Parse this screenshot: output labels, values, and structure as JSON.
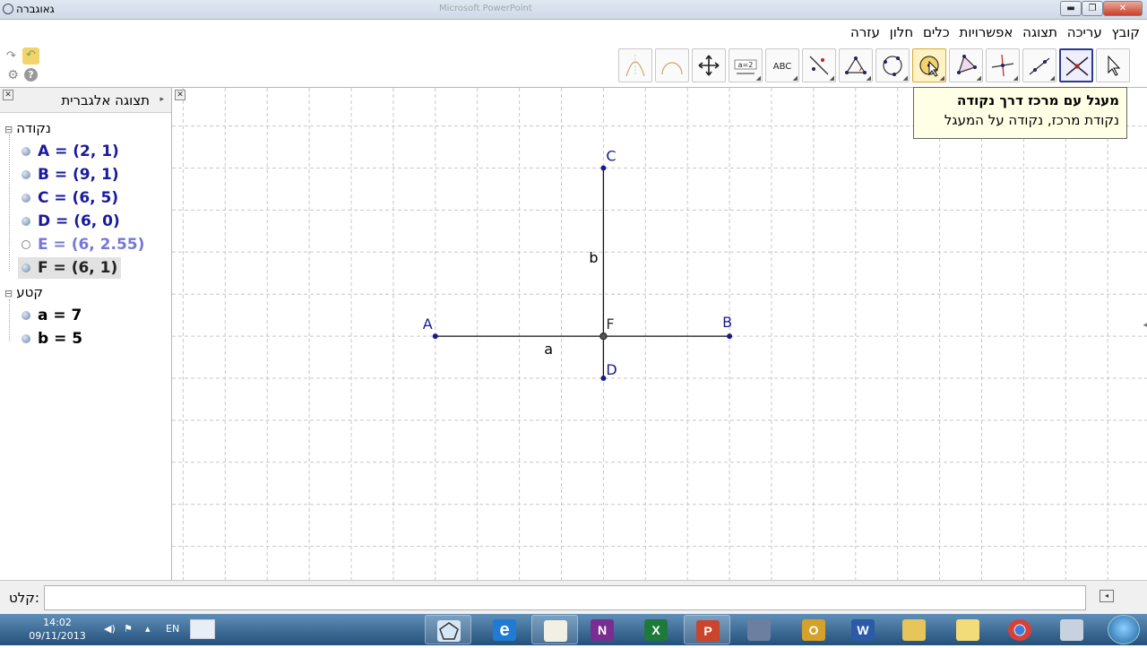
{
  "window": {
    "title": "גאוגברה",
    "background_title": "Microsoft PowerPoint",
    "controls": {
      "minimize": "▬",
      "maximize": "❐",
      "close": "✕"
    }
  },
  "menu": {
    "items": [
      "קובץ",
      "עריכה",
      "תצוגה",
      "אפשרויות",
      "כלים",
      "חלון",
      "עזרה"
    ]
  },
  "toolbar": {
    "tools": [
      {
        "name": "move-tool",
        "icon": "cursor-arrow"
      },
      {
        "name": "point-tool",
        "icon": "intersect-point",
        "active": true
      },
      {
        "name": "line-tool",
        "icon": "line"
      },
      {
        "name": "perpendicular-tool",
        "icon": "perpendicular"
      },
      {
        "name": "polygon-tool",
        "icon": "polygon"
      },
      {
        "name": "circle-tool",
        "icon": "circle-center-point"
      },
      {
        "name": "conic-tool",
        "icon": "circle-three-points"
      },
      {
        "name": "angle-tool",
        "icon": "angle"
      },
      {
        "name": "reflect-tool",
        "icon": "reflect-line"
      },
      {
        "name": "text-tool",
        "icon": "abc",
        "label": "ABC"
      },
      {
        "name": "slider-tool",
        "icon": "slider",
        "label": "a=2"
      },
      {
        "name": "move-view-tool",
        "icon": "move-view"
      },
      {
        "name": "function-tool",
        "icon": "semicircle"
      },
      {
        "name": "function-tool-2",
        "icon": "parabola"
      }
    ]
  },
  "tooltip": {
    "title": "מעגל עם מרכז דרך נקודה",
    "description": "נקודת מרכז, נקודה על המעגל"
  },
  "algebra_view": {
    "title": "תצוגה אלגברית",
    "categories": [
      {
        "label": "נקודה",
        "items": [
          {
            "text": "A = (2, 1)",
            "style": "free"
          },
          {
            "text": "B = (9, 1)",
            "style": "free"
          },
          {
            "text": "C = (6, 5)",
            "style": "free"
          },
          {
            "text": "D = (6, 0)",
            "style": "free"
          },
          {
            "text": "E = (6, 2.55)",
            "style": "auxiliary"
          },
          {
            "text": "F = (6, 1)",
            "style": "selected"
          }
        ]
      },
      {
        "label": "קטע",
        "items": [
          {
            "text": "a = 7",
            "style": "dependent"
          },
          {
            "text": "b = 5",
            "style": "dependent"
          }
        ]
      }
    ]
  },
  "graphics_view": {
    "points": [
      {
        "label": "A",
        "x": 2,
        "y": 1
      },
      {
        "label": "B",
        "x": 9,
        "y": 1
      },
      {
        "label": "C",
        "x": 6,
        "y": 5
      },
      {
        "label": "D",
        "x": 6,
        "y": 0
      },
      {
        "label": "F",
        "x": 6,
        "y": 1
      }
    ],
    "segments": [
      {
        "label": "a",
        "from": "A",
        "to": "B"
      },
      {
        "label": "b",
        "from": "C",
        "to": "D"
      }
    ],
    "grid": true,
    "axes": false
  },
  "input_bar": {
    "label": "קלט:",
    "value": ""
  },
  "taskbar": {
    "time": "14:02",
    "date": "09/11/2013",
    "language": "EN",
    "apps": [
      {
        "name": "geogebra",
        "icon": "pentagon-icon"
      },
      {
        "name": "internet-explorer",
        "label": "e",
        "color": "#1f7bd4"
      },
      {
        "name": "paint",
        "icon": "paint-icon"
      },
      {
        "name": "onenote",
        "label": "N",
        "color": "#7a2e8f"
      },
      {
        "name": "excel",
        "label": "X",
        "color": "#1d7a3a"
      },
      {
        "name": "powerpoint",
        "label": "P",
        "color": "#c9452b"
      },
      {
        "name": "media-player",
        "icon": "film-icon"
      },
      {
        "name": "outlook",
        "label": "O",
        "color": "#d4a12b"
      },
      {
        "name": "word",
        "label": "W",
        "color": "#2a5aa8"
      },
      {
        "name": "explorer",
        "icon": "folder-icon"
      },
      {
        "name": "folder",
        "icon": "folder2-icon"
      },
      {
        "name": "chrome",
        "icon": "chrome-icon"
      },
      {
        "name": "calculator",
        "icon": "calculator-icon"
      }
    ]
  }
}
